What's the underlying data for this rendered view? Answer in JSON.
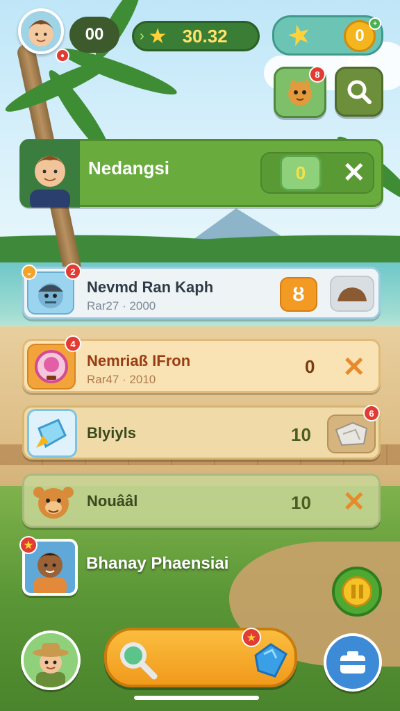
{
  "hud": {
    "player_level": "00",
    "star_score": "30.32",
    "coin_count": "0",
    "pet_badge": "8"
  },
  "featured": {
    "name": "Nedangsi",
    "value": "0"
  },
  "rows": [
    {
      "name": "Nevmd Ran Kaph",
      "sub": "Rar27 · 2000",
      "badge": "2",
      "action_glyph": "ȣ"
    },
    {
      "name": "Nemriaß IFron",
      "sub": "Rar47 · 2010",
      "badge": "4",
      "value": "0"
    },
    {
      "name": "Blyiyls",
      "value": "10",
      "badge": "6"
    },
    {
      "name": "Nouââl",
      "value": "10"
    }
  ],
  "bottom_player": {
    "name": "Bhanay Phaensiai",
    "badge": "★"
  },
  "colors": {
    "accent_green": "#6aab3e",
    "accent_orange": "#f4a32a",
    "close_orange": "#e8892a",
    "badge_red": "#e23b34"
  },
  "icons": [
    "star-icon",
    "coin-icon",
    "pet-icon",
    "search-icon",
    "close-icon",
    "gem-icon",
    "magnifier-icon",
    "camera-icon",
    "pause-icon"
  ]
}
